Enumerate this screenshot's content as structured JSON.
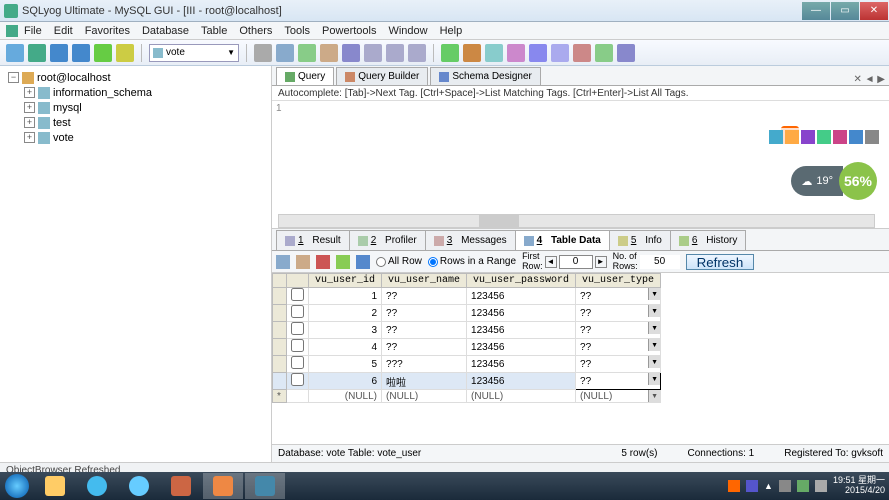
{
  "window": {
    "title": "SQLyog Ultimate - MySQL GUI - [III - root@localhost]"
  },
  "menu": [
    "File",
    "Edit",
    "Favorites",
    "Database",
    "Table",
    "Others",
    "Tools",
    "Powertools",
    "Window",
    "Help"
  ],
  "db_selector": {
    "value": "vote"
  },
  "tree": {
    "root": "root@localhost",
    "children": [
      "information_schema",
      "mysql",
      "test",
      "vote"
    ]
  },
  "upper_tabs": [
    {
      "label": "Query",
      "active": true
    },
    {
      "label": "Query Builder",
      "active": false
    },
    {
      "label": "Schema Designer",
      "active": false
    }
  ],
  "autocomplete_hint": "Autocomplete: [Tab]->Next Tag. [Ctrl+Space]->List Matching Tags. [Ctrl+Enter]->List All Tags.",
  "editor": {
    "line_no": "1"
  },
  "lower_tabs": [
    {
      "num": "1",
      "label": "Result"
    },
    {
      "num": "2",
      "label": "Profiler"
    },
    {
      "num": "3",
      "label": "Messages"
    },
    {
      "num": "4",
      "label": "Table Data",
      "active": true
    },
    {
      "num": "5",
      "label": "Info"
    },
    {
      "num": "6",
      "label": "History"
    }
  ],
  "td_toolbar": {
    "all_row": "All Row",
    "rows_in_range": "Rows in a Range",
    "first_row": "First\nRow:",
    "first_row_val": "0",
    "num_rows": "No. of\nRows:",
    "num_rows_val": "50",
    "refresh": "Refresh"
  },
  "grid": {
    "columns": [
      "vu_user_id",
      "vu_user_name",
      "vu_user_password",
      "vu_user_type"
    ],
    "rows": [
      {
        "id": "1",
        "name": "??",
        "pwd": "123456",
        "type": "??"
      },
      {
        "id": "2",
        "name": "??",
        "pwd": "123456",
        "type": "??"
      },
      {
        "id": "3",
        "name": "??",
        "pwd": "123456",
        "type": "??"
      },
      {
        "id": "4",
        "name": "??",
        "pwd": "123456",
        "type": "??"
      },
      {
        "id": "5",
        "name": "???",
        "pwd": "123456",
        "type": "??"
      },
      {
        "id": "6",
        "name": "啦啦",
        "pwd": "123456",
        "type": "??",
        "selected": true
      }
    ],
    "null_row": {
      "id": "(NULL)",
      "name": "(NULL)",
      "pwd": "(NULL)",
      "type": "(NULL)"
    }
  },
  "status2": {
    "db_info": "Database: vote Table: vote_user",
    "rowcount": "5 row(s)",
    "connections": "Connections: 1",
    "registered": "Registered To: gvksoft"
  },
  "obj_status": "ObjectBrowser Refreshed",
  "weather": {
    "temp": "19°",
    "pct": "56%"
  },
  "sogou": "S",
  "clock": {
    "time": "19:51",
    "day": "星期一",
    "date": "2015/4/20"
  }
}
